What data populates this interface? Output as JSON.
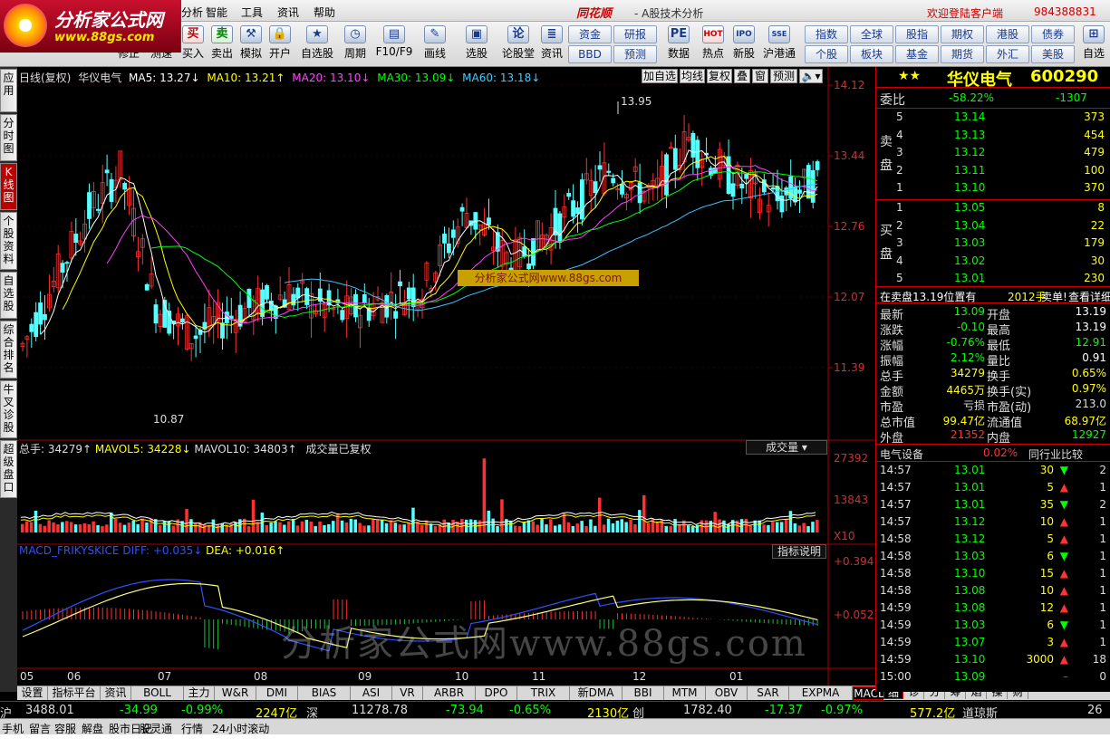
{
  "menubar": {
    "items": [
      "分析",
      "智能",
      "工具",
      "资讯",
      "帮助"
    ],
    "brand": "同花顺",
    "app_title": "- A股技术分析",
    "welcome": "欢迎登陆客户端",
    "account": "984388831"
  },
  "logo": {
    "name": "分析家公式网",
    "url": "www.88gs.com"
  },
  "toolbar": {
    "trade": [
      {
        "label": "修正",
        "icon": "swap-icon"
      },
      {
        "label": "测速",
        "icon": "gauge-icon"
      },
      {
        "label": "买入",
        "icon": "buy-icon",
        "glyph": "买"
      },
      {
        "label": "卖出",
        "icon": "sell-icon",
        "glyph": "卖"
      },
      {
        "label": "模拟",
        "icon": "hammer-icon"
      },
      {
        "label": "开户",
        "icon": "lock-icon"
      }
    ],
    "tools": [
      {
        "label": "自选股",
        "icon": "star-icon"
      },
      {
        "label": "周期",
        "icon": "clock-icon"
      },
      {
        "label": "F10/F9",
        "icon": "document-icon"
      },
      {
        "label": "画线",
        "icon": "pencil-icon"
      },
      {
        "label": "选股",
        "icon": "screen-icon"
      },
      {
        "label": "论股堂",
        "icon": "chat-icon",
        "glyph": "论"
      },
      {
        "label": "资讯",
        "icon": "news-icon"
      },
      {
        "label": "数据",
        "icon": "pe-icon",
        "glyph": "PE"
      },
      {
        "label": "热点",
        "icon": "hot-icon",
        "glyph": "HOT"
      },
      {
        "label": "新股",
        "icon": "ipo-icon",
        "glyph": "IPO"
      },
      {
        "label": "沪港通",
        "icon": "sse-hkex-icon",
        "glyph": "SSE"
      }
    ],
    "grid1": [
      [
        "资金",
        "研报"
      ],
      [
        "BBD",
        "预测"
      ]
    ],
    "grid2": [
      [
        "指数",
        "全球",
        "股指",
        "期权",
        "港股",
        "债券"
      ],
      [
        "个股",
        "板块",
        "基金",
        "期货",
        "外汇",
        "美股"
      ]
    ],
    "more": "自选"
  },
  "sidebar": [
    "应用",
    "分时图",
    "K线图",
    "个股资料",
    "自选股",
    "综合排名",
    "牛叉诊股",
    "超级盘口"
  ],
  "chart": {
    "header": {
      "period": "日线(复权)",
      "name": "华仪电气",
      "ma5": "MA5: 13.27↓",
      "ma10": "MA10: 13.21↑",
      "ma20": "MA20: 13.10↓",
      "ma30": "MA30: 13.09↓",
      "ma60": "MA60: 13.18↓"
    },
    "controls": [
      "加自选",
      "均线",
      "复权",
      "叠",
      "窗",
      "预测"
    ],
    "price_axis": [
      "14.12",
      "13.44",
      "12.76",
      "12.07",
      "11.39"
    ],
    "high_label": "13.95",
    "low_label": "10.87",
    "watermark_box": "分析家公式网www.88gs.com",
    "volume": {
      "total": "总手: 34279↑",
      "mavol5": "MAVOL5: 34228↓",
      "mavol10": "MAVOL10: 34803↑",
      "note": "成交量已复权",
      "selector": "成交量",
      "axis": [
        "27392",
        "13843",
        "X10"
      ]
    },
    "macd": {
      "name": "MACD_FRIKYSKICE",
      "diff": "DIFF: +0.035↓",
      "dea": "DEA: +0.016↑",
      "help": "指标说明",
      "axis": [
        "+0.394",
        "+0.052"
      ]
    },
    "months": [
      "05",
      "06",
      "07",
      "08",
      "09",
      "10",
      "11",
      "12",
      "01"
    ],
    "big_watermark": "分析家公式网www.88gs.com",
    "colors": {
      "ma5": "#ffffff",
      "ma10": "#ffff00",
      "ma20": "#ff40ff",
      "ma30": "#00ff00",
      "ma60": "#40c0ff",
      "up": "#ff3030",
      "down": "#54ffff"
    }
  },
  "bottom_tabs": [
    "设置",
    "指标平台",
    "资讯",
    "BOLL",
    "主力",
    "W&R",
    "DMI",
    "BIAS",
    "ASI",
    "VR",
    "ARBR",
    "DPO",
    "TRIX",
    "新DMA",
    "BBI",
    "MTM",
    "OBV",
    "SAR",
    "EXPMA",
    "MACD_FRIKYSKICE"
  ],
  "right_tabs": [
    "细",
    "诊",
    "分",
    "筹",
    "焰",
    "操",
    "财"
  ],
  "quote": {
    "stars": "★★",
    "name": "华仪电气",
    "code": "600290",
    "weibi": {
      "label": "委比",
      "pct": "-58.22%",
      "diff": "-1307"
    },
    "sell_label": "卖盘",
    "buy_label": "买盘",
    "sell": [
      {
        "lvl": "5",
        "price": "13.14",
        "vol": "373"
      },
      {
        "lvl": "4",
        "price": "13.13",
        "vol": "454"
      },
      {
        "lvl": "3",
        "price": "13.12",
        "vol": "479"
      },
      {
        "lvl": "2",
        "price": "13.11",
        "vol": "100"
      },
      {
        "lvl": "1",
        "price": "13.10",
        "vol": "370"
      }
    ],
    "buy": [
      {
        "lvl": "1",
        "price": "13.05",
        "vol": "8"
      },
      {
        "lvl": "2",
        "price": "13.04",
        "vol": "22"
      },
      {
        "lvl": "3",
        "price": "13.03",
        "vol": "179"
      },
      {
        "lvl": "4",
        "price": "13.02",
        "vol": "30"
      },
      {
        "lvl": "5",
        "price": "13.01",
        "vol": "230"
      }
    ],
    "notice": "在卖盘13.19位置有",
    "notice_vol": "2012手",
    "notice_tail": "卖单!",
    "detail": "查看详细",
    "stats": [
      [
        "最新",
        "13.09",
        "开盘",
        "13.19"
      ],
      [
        "涨跌",
        "-0.10",
        "最高",
        "13.19"
      ],
      [
        "涨幅",
        "-0.76%",
        "最低",
        "12.91"
      ],
      [
        "振幅",
        "2.12%",
        "量比",
        "0.91"
      ],
      [
        "总手",
        "34279",
        "换手",
        "0.65%"
      ],
      [
        "金额",
        "4465万",
        "换手(实)",
        "0.97%"
      ],
      [
        "市盈",
        "亏损",
        "市盈(动)",
        "213.0"
      ],
      [
        "总市值",
        "99.47亿",
        "流通值",
        "68.97亿"
      ],
      [
        "外盘",
        "21352",
        "内盘",
        "12927"
      ]
    ],
    "industry": "电气设备",
    "industry_pct": "0.02%",
    "compare": "同行业比较",
    "ticks": [
      [
        "14:57",
        "13.01",
        "30",
        "down",
        "2"
      ],
      [
        "14:57",
        "13.01",
        "5",
        "up",
        "1"
      ],
      [
        "14:57",
        "13.01",
        "35",
        "down",
        "2"
      ],
      [
        "14:57",
        "13.12",
        "10",
        "up",
        "1"
      ],
      [
        "14:58",
        "13.12",
        "5",
        "up",
        "1"
      ],
      [
        "14:58",
        "13.03",
        "6",
        "down",
        "1"
      ],
      [
        "14:58",
        "13.10",
        "15",
        "up",
        "1"
      ],
      [
        "14:58",
        "13.08",
        "10",
        "up",
        "1"
      ],
      [
        "14:59",
        "13.08",
        "12",
        "up",
        "1"
      ],
      [
        "14:59",
        "13.03",
        "6",
        "down",
        "1"
      ],
      [
        "14:59",
        "13.07",
        "3",
        "up",
        "1"
      ],
      [
        "14:59",
        "13.10",
        "3000",
        "up",
        "18"
      ],
      [
        "15:00",
        "13.09",
        "",
        "flat",
        "0"
      ]
    ]
  },
  "ticker": {
    "sh": "沪",
    "sh_val": "3488.01",
    "sh_chg": "-34.99",
    "sh_pct": "-0.99%",
    "sh_amt": "2247亿",
    "sz": "深",
    "sz_val": "11278.78",
    "sz_chg": "-73.94",
    "sz_pct": "-0.65%",
    "sz_amt": "2130亿",
    "cy": "创",
    "cy_val": "1782.40",
    "cy_chg": "-17.37",
    "cy_pct": "-0.97%",
    "cy_amt": "577.2亿",
    "dj": "道琼斯",
    "dj_val": "26"
  },
  "status": [
    "手机",
    "留言",
    "容服",
    "解盘",
    "股市日记",
    "股灵通",
    "行情",
    "24小时滚动"
  ]
}
